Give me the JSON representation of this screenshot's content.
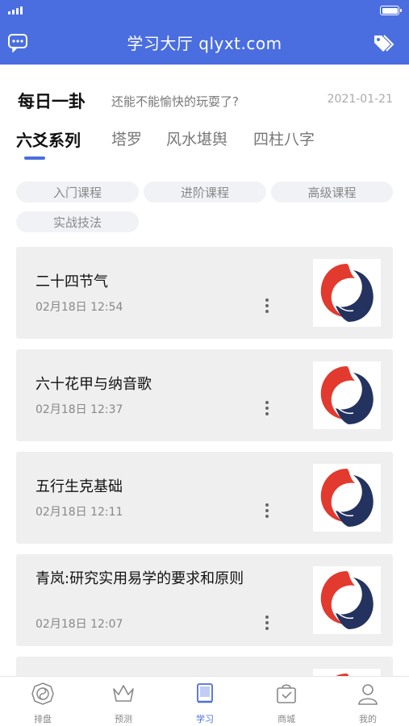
{
  "header": {
    "title": "学习大厅 qlyxt.com",
    "left_icon": "chat-bubble-icon",
    "right_icon": "tag-icon",
    "accent_color": "#4a6ee0"
  },
  "daily": {
    "title": "每日一卦",
    "subtitle": "还能不能愉快的玩耍了?",
    "date": "2021-01-21"
  },
  "tabs": [
    {
      "label": "六爻系列",
      "active": true
    },
    {
      "label": "塔罗",
      "active": false
    },
    {
      "label": "风水堪舆",
      "active": false
    },
    {
      "label": "四柱八字",
      "active": false
    }
  ],
  "chips": [
    "入门课程",
    "进阶课程",
    "高级课程",
    "实战技法"
  ],
  "courses": [
    {
      "title": "二十四节气",
      "time": "02月18日 12:54",
      "thumb_icon": "phoenix-logo-icon"
    },
    {
      "title": "六十花甲与纳音歌",
      "time": "02月18日 12:37",
      "thumb_icon": "phoenix-logo-icon"
    },
    {
      "title": "五行生克基础",
      "time": "02月18日 12:11",
      "thumb_icon": "phoenix-logo-icon"
    },
    {
      "title": "青岚:研究实用易学的要求和原则",
      "time": "02月18日 12:07",
      "thumb_icon": "phoenix-logo-icon"
    }
  ],
  "tabbar": [
    {
      "label": "排盘",
      "icon": "bagua-icon",
      "active": false
    },
    {
      "label": "预测",
      "icon": "crown-icon",
      "active": false
    },
    {
      "label": "学习",
      "icon": "book-icon",
      "active": true
    },
    {
      "label": "商城",
      "icon": "shopping-bag-icon",
      "active": false
    },
    {
      "label": "我的",
      "icon": "user-icon",
      "active": false
    }
  ]
}
